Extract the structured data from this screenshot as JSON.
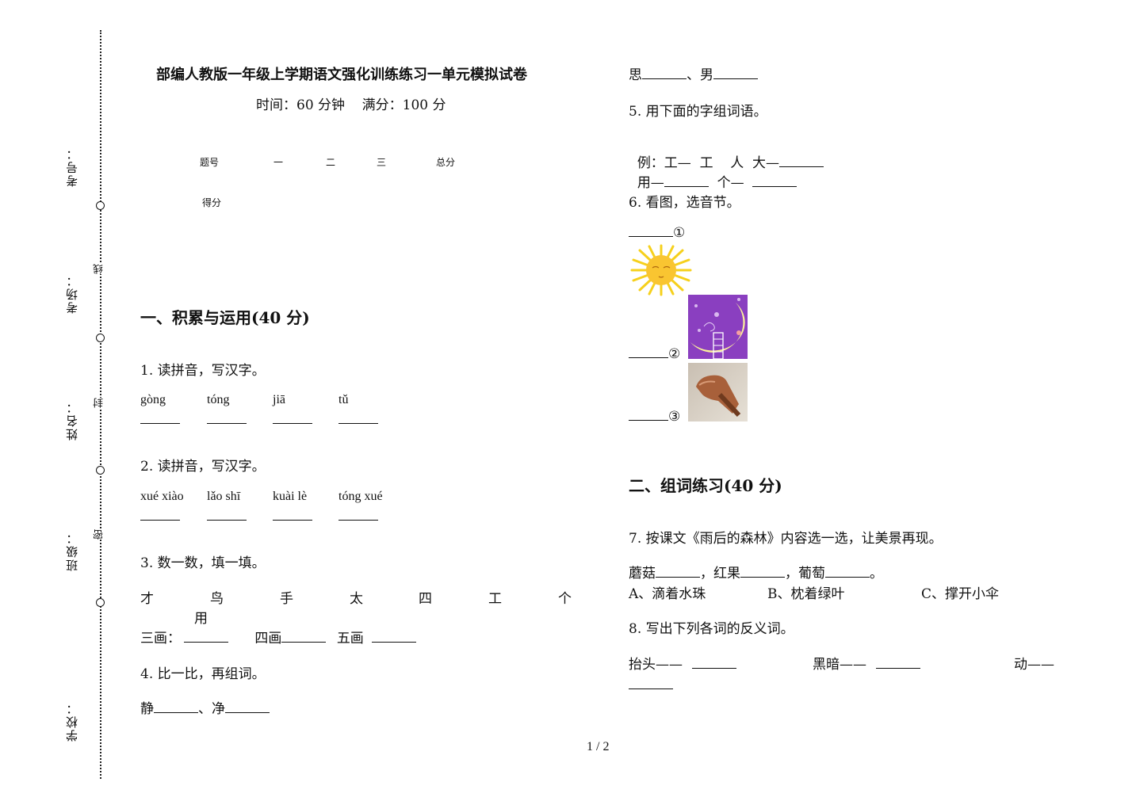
{
  "binding": {
    "labels": [
      "考号：",
      "考场：",
      "姓名：",
      "班级：",
      "学校："
    ],
    "cut_marks": [
      "线",
      "封",
      "密"
    ]
  },
  "header": {
    "title": "部编人教版一年级上学期语文强化训练练习一单元模拟试卷",
    "subtitle": "时间：60 分钟    满分：100 分"
  },
  "score_table": {
    "row1": [
      "题号",
      "一",
      "二",
      "三",
      "总分"
    ],
    "row2_label": "得分"
  },
  "sections": [
    {
      "title": "一、积累与运用(40 分)"
    },
    {
      "title": "二、组词练习(40 分)"
    }
  ],
  "questions": {
    "q1": {
      "prompt": "1.  读拼音，写汉字。",
      "pinyin": [
        "gòng",
        "tóng",
        "jiā",
        "tǔ"
      ]
    },
    "q2": {
      "prompt": "2.  读拼音，写汉字。",
      "pinyin": [
        "xué xiào",
        "lǎo shī",
        "kuài lè",
        "tóng xué"
      ]
    },
    "q3": {
      "prompt": "3.  数一数，填一填。",
      "chars": [
        "才",
        "鸟",
        "手",
        "太",
        "四",
        "工",
        "个",
        "用"
      ],
      "fill": [
        "三画：",
        "四画",
        "五画"
      ]
    },
    "q4": {
      "prompt": "4.  比一比，再组词。",
      "line1": [
        "静",
        "、净"
      ],
      "line2": [
        "思",
        "、男"
      ]
    },
    "q5": {
      "prompt": "5.  用下面的字组词语。",
      "line1": "例：工—  工    人  大—",
      "line2a": "用—",
      "line2b": "  个—  "
    },
    "q6": {
      "prompt": "6.  看图，选音节。",
      "markers": [
        "①",
        "②",
        "③"
      ],
      "images": [
        "sun-picture",
        "moon-picture",
        "hand-picture"
      ]
    },
    "q7": {
      "prompt": "7.  按课文《雨后的森林》内容选一选，让美景再现。",
      "fill": [
        "蘑菇",
        "，红果",
        "，葡萄",
        "。"
      ],
      "options": [
        "A、滴着水珠",
        "B、枕着绿叶",
        "C、撑开小伞"
      ]
    },
    "q8": {
      "prompt": "8.  写出下列各词的反义词。",
      "items": [
        "抬头——",
        "黑暗——",
        "动——"
      ]
    }
  },
  "footer": {
    "page": "1 / 2"
  }
}
